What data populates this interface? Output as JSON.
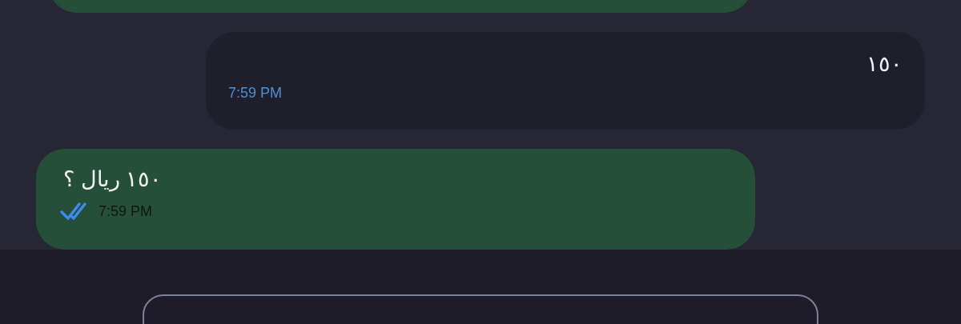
{
  "messages": [
    {
      "kind": "outgoing"
    },
    {
      "kind": "incoming",
      "text": "١٥٠",
      "time": "7:59 PM"
    },
    {
      "kind": "outgoing",
      "text": "١٥٠ ريال ؟",
      "time": "7:59 PM",
      "read": true
    }
  ]
}
